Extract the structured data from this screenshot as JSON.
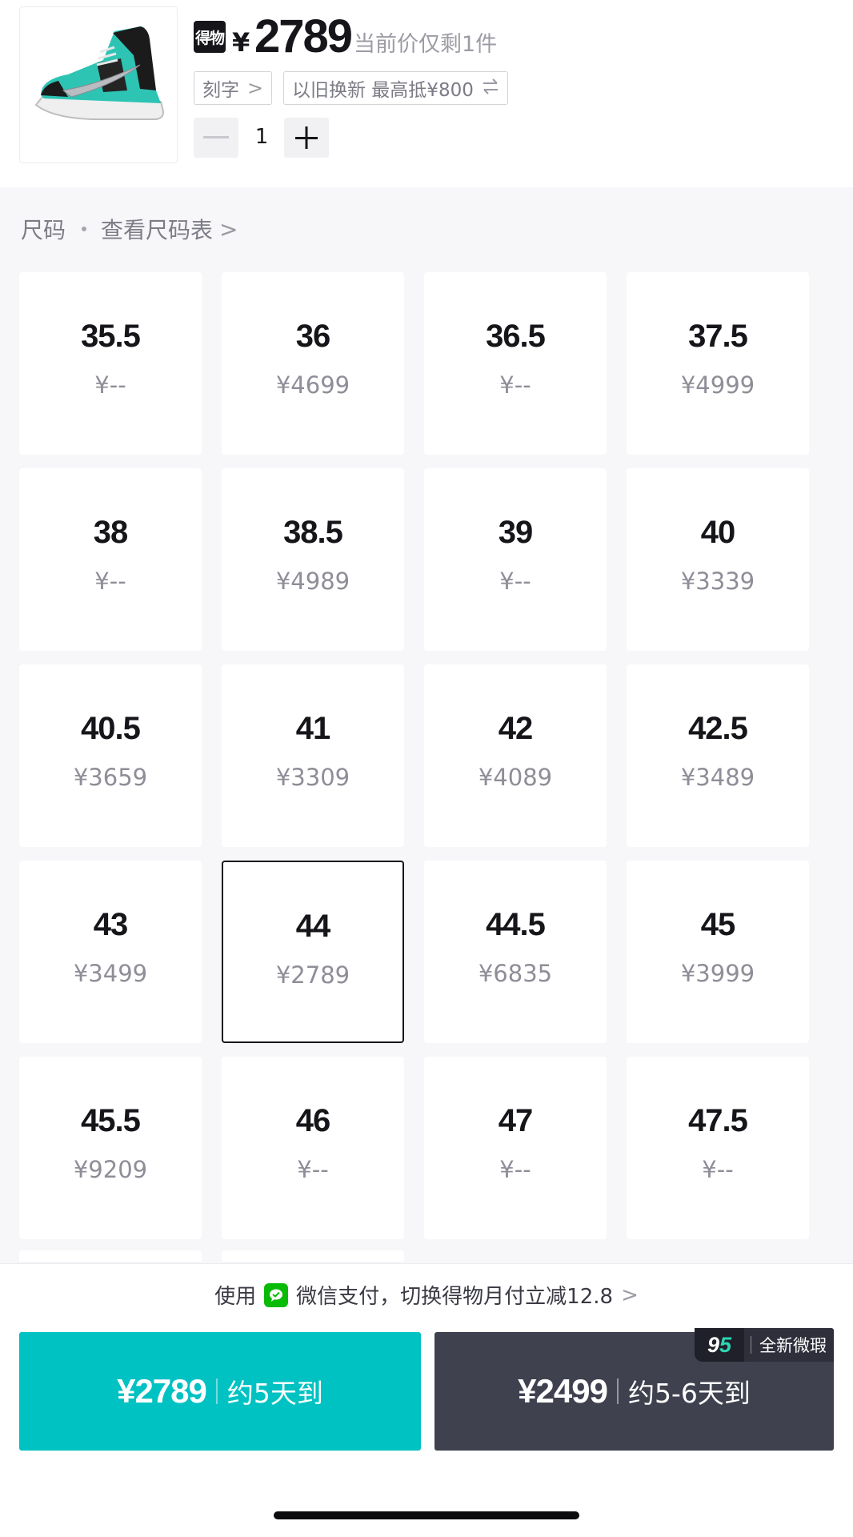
{
  "header": {
    "brand_text": "得物",
    "currency": "¥",
    "price": "2789",
    "stock_note": "当前价仅剩1件",
    "tag_engrave": "刻字",
    "tag_trade_in": "以旧换新 最高抵¥800",
    "quantity": "1"
  },
  "size_section": {
    "label": "尺码",
    "chart_link": "查看尺码表"
  },
  "sizes": [
    {
      "size": "35.5",
      "price": "¥--"
    },
    {
      "size": "36",
      "price": "¥4699"
    },
    {
      "size": "36.5",
      "price": "¥--"
    },
    {
      "size": "37.5",
      "price": "¥4999"
    },
    {
      "size": "38",
      "price": "¥--"
    },
    {
      "size": "38.5",
      "price": "¥4989"
    },
    {
      "size": "39",
      "price": "¥--"
    },
    {
      "size": "40",
      "price": "¥3339"
    },
    {
      "size": "40.5",
      "price": "¥3659"
    },
    {
      "size": "41",
      "price": "¥3309"
    },
    {
      "size": "42",
      "price": "¥4089"
    },
    {
      "size": "42.5",
      "price": "¥3489"
    },
    {
      "size": "43",
      "price": "¥3499"
    },
    {
      "size": "44",
      "price": "¥2789"
    },
    {
      "size": "44.5",
      "price": "¥6835"
    },
    {
      "size": "45",
      "price": "¥3999"
    },
    {
      "size": "45.5",
      "price": "¥9209"
    },
    {
      "size": "46",
      "price": "¥--"
    },
    {
      "size": "47",
      "price": "¥--"
    },
    {
      "size": "47.5",
      "price": "¥--"
    }
  ],
  "selected_size": "44",
  "payment": {
    "prefix": "使用",
    "method": "微信支付，切换得物月付立减12.8"
  },
  "buy_new": {
    "price": "¥2789",
    "eta": "约5天到"
  },
  "buy_95": {
    "price": "¥2499",
    "eta": "约5-6天到",
    "badge_logo_9": "9",
    "badge_logo_5": "5",
    "badge_text": "全新微瑕"
  },
  "colors": {
    "primary": "#01c2c3",
    "secondary": "#40414f",
    "wechat": "#09bb07"
  }
}
